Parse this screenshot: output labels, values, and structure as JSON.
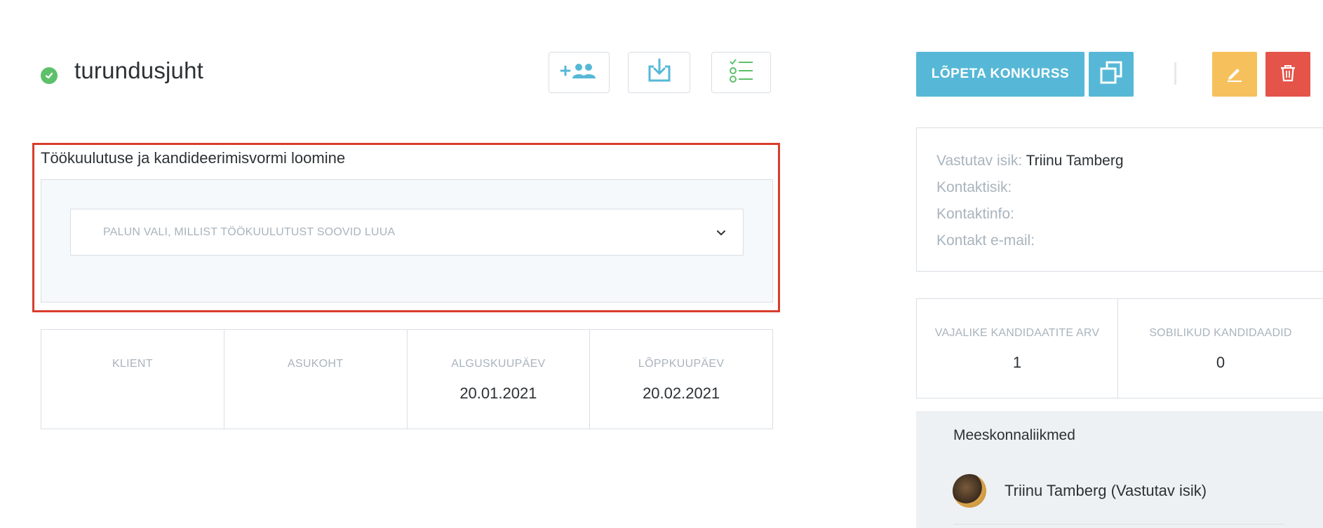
{
  "header": {
    "title": "turundusjuht",
    "status": "active",
    "tools": [
      {
        "name": "add-candidates",
        "icon": "add-people-icon"
      },
      {
        "name": "download",
        "icon": "download-icon"
      },
      {
        "name": "checklist",
        "icon": "checklist-icon"
      }
    ]
  },
  "actions": {
    "end_label": "LÕPETA KONKURSS",
    "copy_icon": "copy-icon",
    "edit_icon": "pencil-icon",
    "delete_icon": "trash-icon"
  },
  "ad_section": {
    "title": "Töökuulutuse ja kandideerimisvormi loomine",
    "select_placeholder": "PALUN VALI, MILLIST TÖÖKUULUTUST SOOVID LUUA"
  },
  "info": [
    {
      "label": "KLIENT",
      "value": ""
    },
    {
      "label": "ASUKOHT",
      "value": ""
    },
    {
      "label": "ALGUSKUUPÄEV",
      "value": "20.01.2021"
    },
    {
      "label": "LÕPPKUUPÄEV",
      "value": "20.02.2021"
    }
  ],
  "contacts": {
    "responsible_label": "Vastutav isik:",
    "responsible_value": "Triinu Tamberg",
    "contact_person_label": "Kontaktisik:",
    "contact_info_label": "Kontaktinfo:",
    "contact_email_label": "Kontakt e-mail:"
  },
  "stats": [
    {
      "label": "VAJALIKE KANDIDAATITE ARV",
      "value": "1"
    },
    {
      "label": "SOBILIKUD KANDIDAADID",
      "value": "0"
    }
  ],
  "team": {
    "title": "Meeskonnaliikmed",
    "members": [
      {
        "name": "Triinu Tamberg (Vastutav isik)"
      }
    ]
  },
  "colors": {
    "primary": "#56b8d6",
    "edit": "#f6c15d",
    "delete": "#e45449",
    "success": "#5cc16a",
    "highlight": "#d83d2d"
  }
}
